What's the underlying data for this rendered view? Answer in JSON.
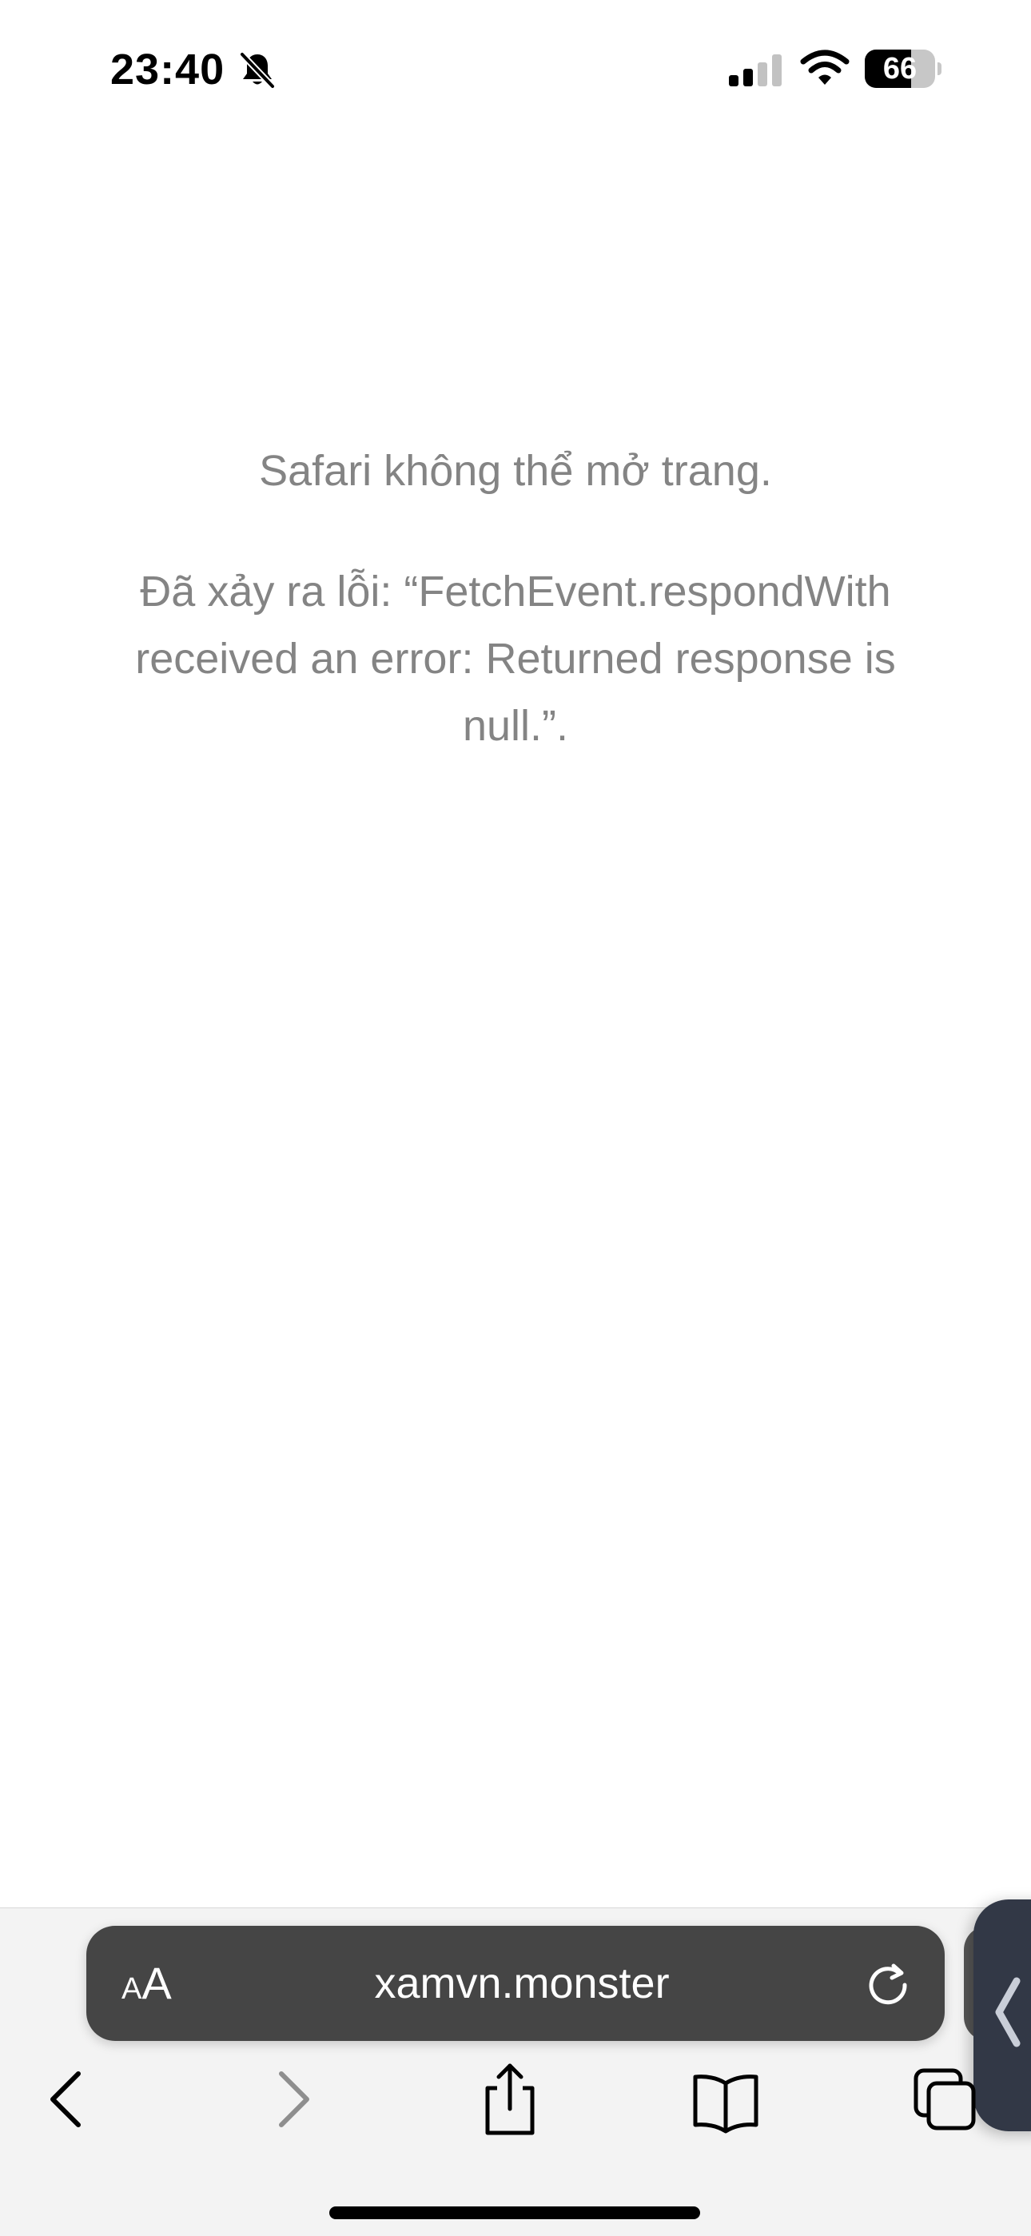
{
  "status_bar": {
    "time": "23:40",
    "battery_level": "66",
    "battery_fraction": 0.66,
    "signal_bars_active": 2,
    "icons": [
      "bell-slash-icon",
      "cellular-signal-icon",
      "wifi-icon",
      "battery-icon"
    ]
  },
  "error": {
    "title": "Safari không thể mở trang.",
    "detail": "Đã xảy ra lỗi: “FetchEvent.respondWith received an error: Returned response is null.”."
  },
  "address_bar": {
    "aa_small": "A",
    "aa_large": "A",
    "url": "xamvn.monster",
    "reload_icon": "reload-icon"
  },
  "toolbar": {
    "buttons": [
      "back-icon",
      "forward-icon",
      "share-icon",
      "bookmarks-icon",
      "tabs-icon"
    ]
  },
  "colors": {
    "error_text": "#848484",
    "address_bar_bg": "#454545",
    "toolbar_bg": "#f3f3f3",
    "side_panel_bg": "#323846"
  }
}
